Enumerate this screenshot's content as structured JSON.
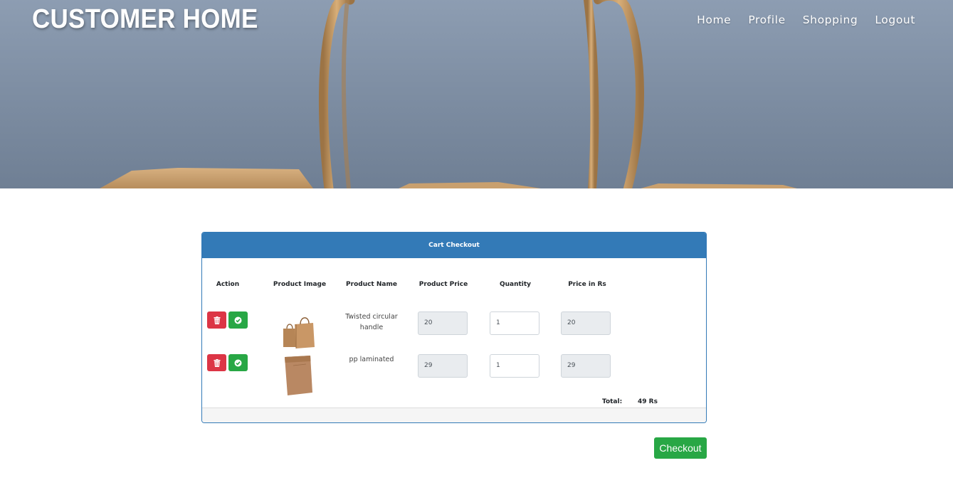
{
  "header": {
    "brand": "CUSTOMER HOME",
    "nav": [
      "Home",
      "Profile",
      "Shopping",
      "Logout"
    ]
  },
  "cart": {
    "title": "Cart Checkout",
    "columns": [
      "Action",
      "Product Image",
      "Product Name",
      "Product Price",
      "Quantity",
      "Price in Rs"
    ],
    "items": [
      {
        "name": "Twisted circular handle",
        "price": "20",
        "quantity": "1",
        "line_total": "20"
      },
      {
        "name": "pp laminated",
        "price": "29",
        "quantity": "1",
        "line_total": "29"
      }
    ],
    "total_label": "Total:",
    "total_value": "49 Rs"
  },
  "checkout_label": "Checkout",
  "colors": {
    "primary": "#337ab7",
    "danger": "#dc3545",
    "success": "#28a745"
  },
  "icons": {
    "delete": "trash-icon",
    "confirm": "check-circle-icon"
  }
}
